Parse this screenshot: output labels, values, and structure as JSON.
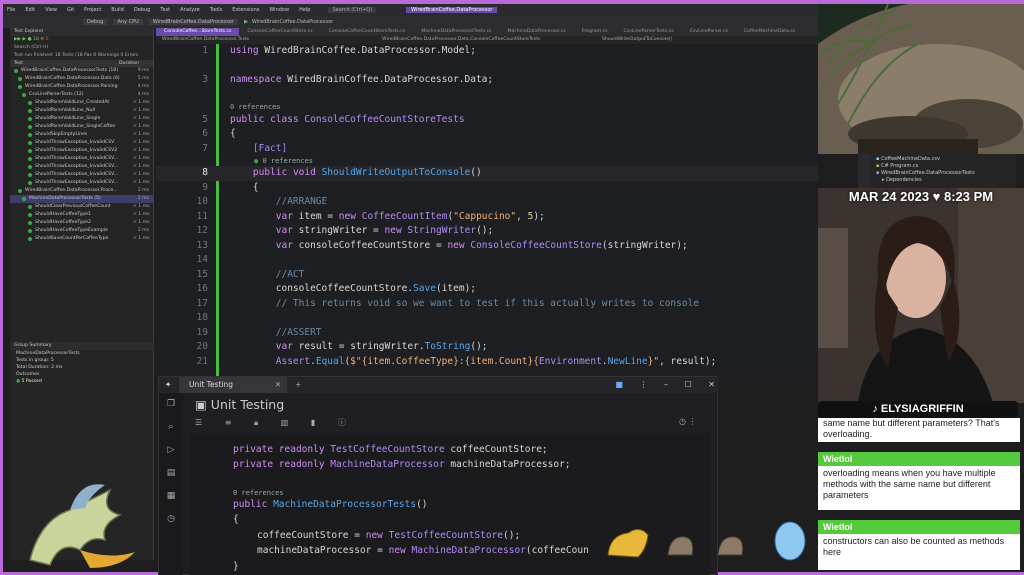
{
  "menubar": {
    "items": [
      "File",
      "Edit",
      "View",
      "Git",
      "Project",
      "Build",
      "Debug",
      "Test",
      "Analyze",
      "Tools",
      "Extensions",
      "Window",
      "Help"
    ],
    "search": "Search (Ctrl+Q)",
    "project": "WiredBrainCoffee.DataProcessor"
  },
  "toolbar": {
    "config": "Debug",
    "platform": "Any CPU",
    "project": "WiredBrainCoffee.DataProcessor",
    "run": "WiredBrainCoffee.DataProcessor"
  },
  "test_explorer": {
    "title": "Test Explorer",
    "search": "Search (Ctrl+I)",
    "status": "Test run finished: 18 Tests (18 Pas  0 Warnings  0 Errors",
    "col_test": "Test",
    "col_duration": "Duration",
    "rows": [
      {
        "name": "WiredBrainCoffee.DataProcessorTests (18)",
        "duration": "9 ms"
      },
      {
        "name": "WiredBrainCoffee.DataProcessor.Data (6)",
        "duration": "5 ms"
      },
      {
        "name": "WiredBrainCoffee.DataProcessor.Parsing",
        "duration": "4 ms"
      },
      {
        "name": "CsvLineParserTests (12)",
        "duration": "4 ms"
      },
      {
        "name": "ShouldParseValidLine_CreatedAt",
        "duration": "< 1 ms"
      },
      {
        "name": "ShouldParseValidLine_Null",
        "duration": "< 1 ms"
      },
      {
        "name": "ShouldParseValidLine_Single",
        "duration": "< 1 ms"
      },
      {
        "name": "ShouldParseValidLine_SingleCoffee",
        "duration": "< 1 ms"
      },
      {
        "name": "ShouldSkipEmptyLines",
        "duration": "< 1 ms"
      },
      {
        "name": "ShouldThrowException_InvalidCSV",
        "duration": "< 1 ms"
      },
      {
        "name": "ShouldThrowException_InvalidCSV2",
        "duration": "< 1 ms"
      },
      {
        "name": "ShouldThrowException_InvalidCSV...",
        "duration": "< 1 ms"
      },
      {
        "name": "ShouldThrowException_InvalidCSV...",
        "duration": "< 1 ms"
      },
      {
        "name": "ShouldThrowException_InvalidCSV...",
        "duration": "< 1 ms"
      },
      {
        "name": "ShouldThrowException_InvalidCSV...",
        "duration": "< 1 ms"
      },
      {
        "name": "WiredBrainCoffee.DataProcessor.Proce...",
        "duration": "2 ms"
      },
      {
        "name": "MachineDataProcessorTests (5)",
        "duration": "2 ms"
      },
      {
        "name": "ShouldClearPreviousCoffeeCount",
        "duration": "< 1 ms"
      },
      {
        "name": "ShouldHaveCoffeeType1",
        "duration": "< 1 ms"
      },
      {
        "name": "ShouldHaveCoffeeType2",
        "duration": "< 1 ms"
      },
      {
        "name": "ShouldHaveCoffeeTypeExample",
        "duration": "2 ms"
      },
      {
        "name": "ShouldSaveCountPerCoffeeType",
        "duration": "< 1 ms"
      }
    ],
    "group_summary": {
      "header": "Group Summary",
      "name": "MachineDataProcessorTests",
      "tests_in_group": "Tests in group: 5",
      "total_duration": "Total Duration: 2 ms",
      "outcomes": "Outcomes",
      "passed": "5 Passed"
    }
  },
  "doc_tabs": [
    "ConsoleCoffee...StoreTests.cs",
    "ConsoleCoffeeCountStore.cs",
    "ConsoleCoffeeCountStoreTests.cs",
    "MachineDataProcessorTests.cs",
    "MachineDataProcessor.cs",
    "Program.cs",
    "CsvLineParserTests.cs",
    "CsvLineParser.cs",
    "CoffeeMachineData.cs"
  ],
  "navbar": {
    "project": "WiredBrainCoffee.DataProcessor.Tests",
    "class": "WiredBrainCoffee.DataProcessor.Data.ConsoleCoffeeCountStoreTests",
    "member": "ShouldWriteOutputToConsole()"
  },
  "editor": {
    "refs": "0 references",
    "lines": {
      "l1": "1",
      "using": "using",
      "using_ns": "WiredBrainCoffee.DataProcessor.Model;",
      "l3": "3",
      "namespace": "namespace",
      "ns": "WiredBrainCoffee.DataProcessor.Data;",
      "l5": "5",
      "public": "public",
      "class": "class",
      "classname": "ConsoleCoffeeCountStoreTests",
      "l6": "6",
      "lb": "{",
      "l7": "7",
      "fact": "[Fact]",
      "l8": "8",
      "void": "void",
      "method": "ShouldWriteOutputToConsole",
      "paren": "()",
      "l9": "9",
      "l10": "10",
      "c_arrange": "//ARRANGE",
      "l11": "11",
      "var": "var",
      "item": "item",
      "eq": "=",
      "new": "new",
      "cci": "CoffeeCountItem",
      "cappuccino": "\"Cappucino\"",
      "five": "5",
      "l12": "12",
      "sw": "stringWriter",
      "swtype": "StringWriter",
      "l13": "13",
      "ccs": "consoleCoffeeCountStore",
      "ccstype": "ConsoleCoffeeCountStore",
      "l14": "14",
      "l15": "15",
      "c_act": "//ACT",
      "l16": "16",
      "save": "Save",
      "l17": "17",
      "c_returns": "// This returns void so we want to test if this actually writes to console",
      "l18": "18",
      "l19": "19",
      "c_assert": "//ASSERT",
      "l20": "20",
      "result": "result",
      "tostring": "ToString",
      "l21": "21",
      "assert": "Assert",
      "equal": "Equal",
      "interp1": "$\"{item.CoffeeType}:{item.Count}{",
      "env": "Environment",
      "newline": "NewLine",
      "interp2": "}\"",
      "result_arg": "result);"
    }
  },
  "solution_explorer": {
    "items": [
      "CoffeeMachineData.csv",
      "C# Program.cs",
      "WiredBrainCoffee.DataProcessorTests",
      "Dependencies"
    ]
  },
  "stream": {
    "timestamp": "MAR 24 2023 ♥ 8:23 PM",
    "handle": "ELYSIAGRIFFIN"
  },
  "chat": [
    {
      "name": "",
      "text": "same name but different parameters? That's overloading."
    },
    {
      "name": "Wietlol",
      "text": "overloading means when you have multiple methods with the same name but different parameters"
    },
    {
      "name": "Wietlol",
      "text": "constructors can also be counted as methods here"
    }
  ],
  "unit_panel": {
    "tab": "Unit Testing",
    "title": "Unit Testing",
    "refs": "0 references",
    "code": {
      "private": "private",
      "readonly": "readonly",
      "tcs": "TestCoffeeCountStore",
      "tcs_var": "coffeeCountStore;",
      "mdp": "MachineDataProcessor",
      "mdp_var": "machineDataProcessor;",
      "public": "public",
      "ctor": "MachineDataProcessorTests",
      "paren": "()",
      "lb": "{",
      "ccs": "coffeeCountStore",
      "eq": "=",
      "new": "new",
      "tcs_ctor": "TestCoffeeCountStore",
      "args0": "();",
      "mdp_field": "machineDataProcessor",
      "mdp_ctor": "MachineDataProcessor",
      "args1": "(coffeeCoun",
      "rb": "}"
    }
  },
  "colors": {
    "frame": "#b76ad8",
    "active_tab": "#6a4ca8",
    "chat_name": "#54c93b",
    "pass": "#3ca74a"
  }
}
